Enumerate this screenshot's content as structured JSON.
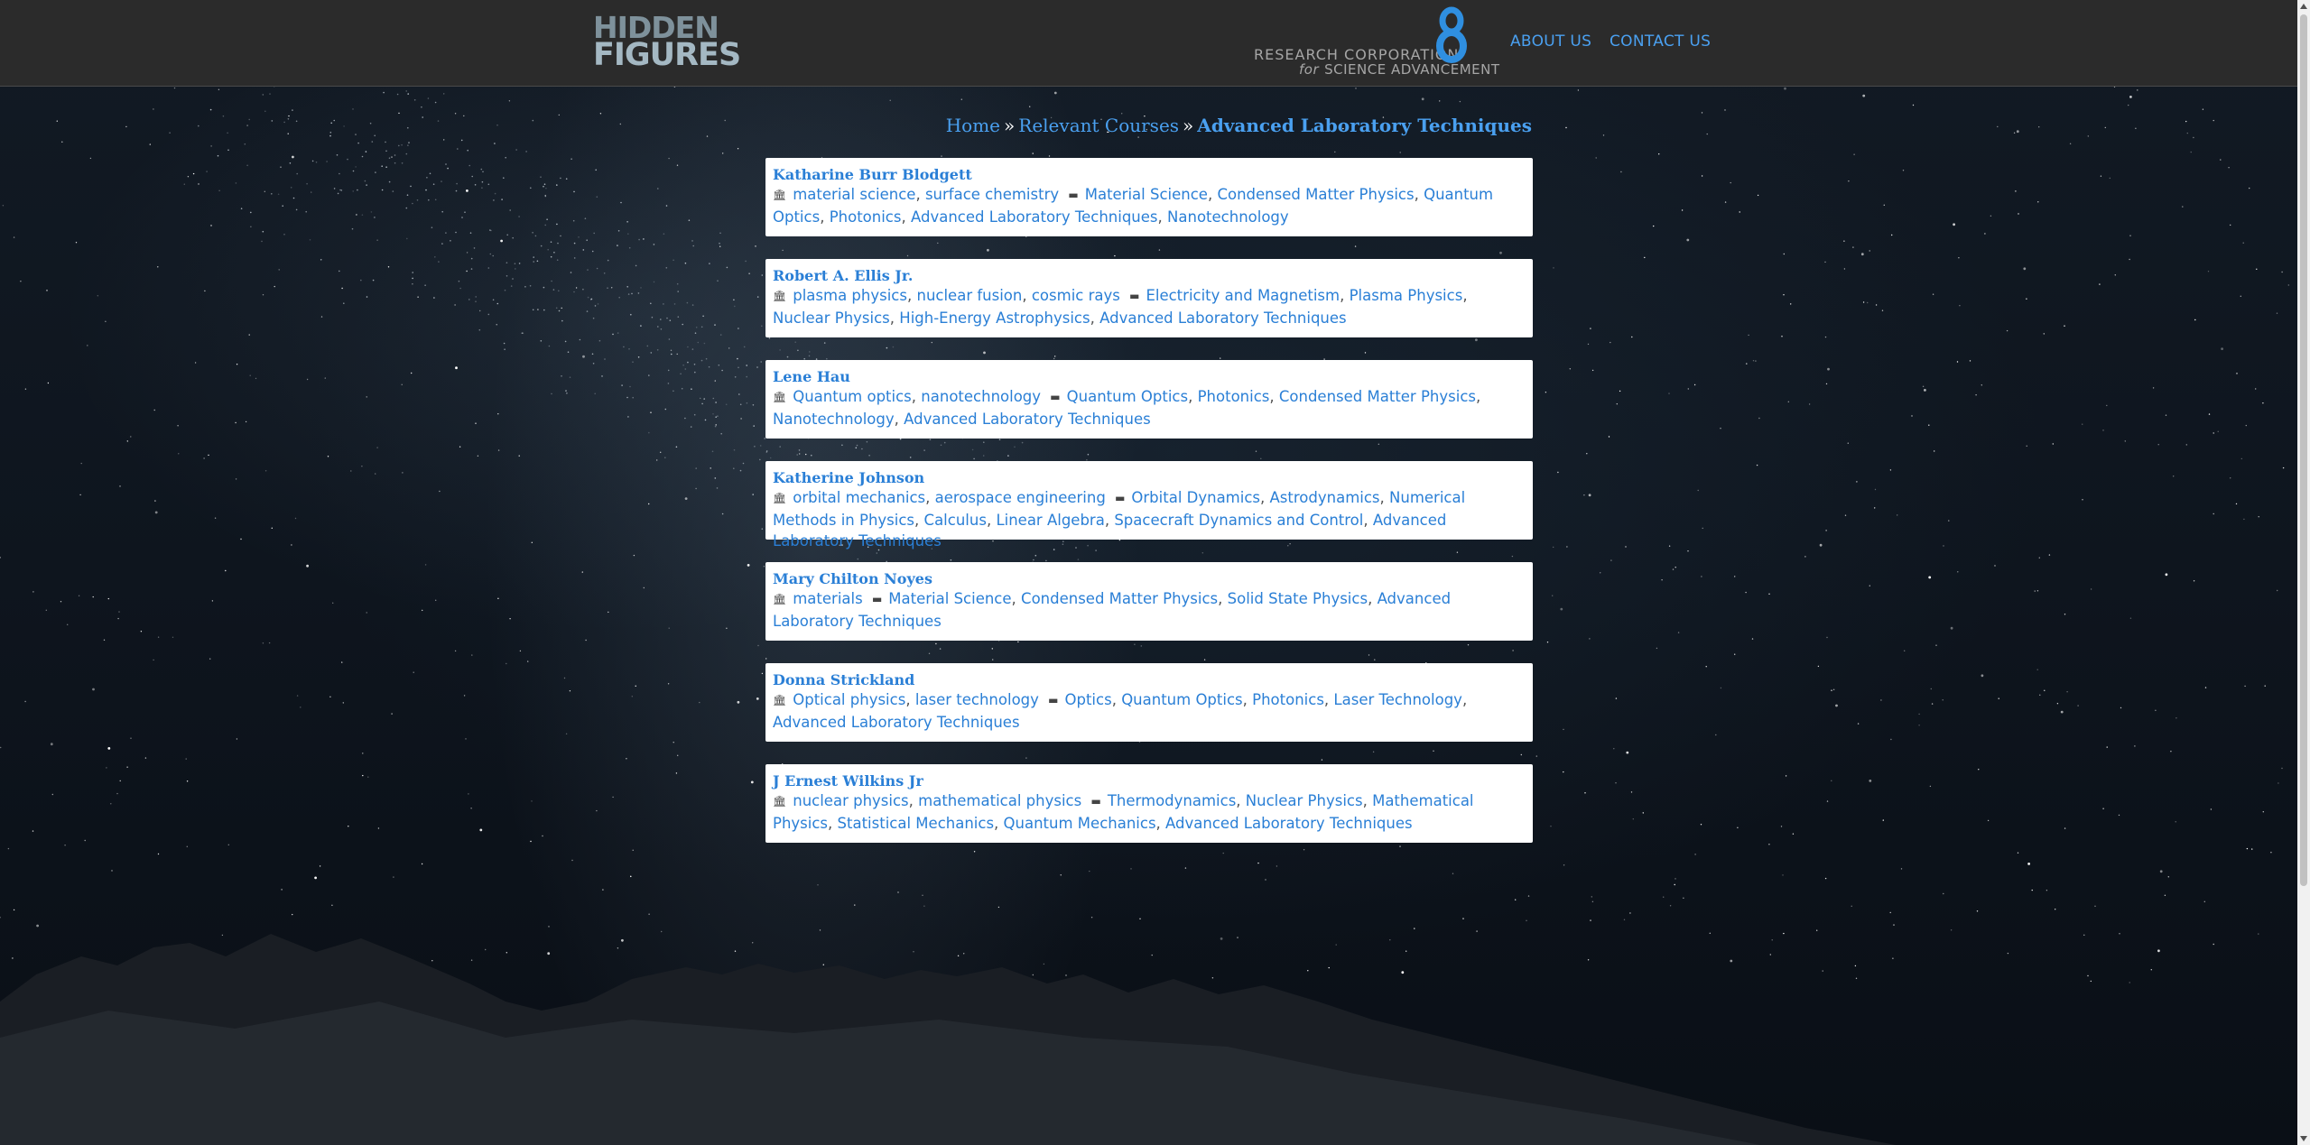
{
  "header": {
    "logo_line1": "HIDDEN",
    "logo_line2": "FIGURES",
    "org_line1": "RESEARCH CORPORATION",
    "org_line2_for": "for",
    "org_line2_rest": "SCIENCE ADVANCEMENT",
    "nav": {
      "about": "ABOUT US",
      "contact": "CONTACT US"
    }
  },
  "breadcrumb": {
    "home": "Home",
    "sep": "»",
    "parent": "Relevant Courses",
    "current": "Advanced Laboratory Techniques"
  },
  "icons": {
    "field": "institution-icon",
    "course": "book-icon"
  },
  "colors": {
    "link": "#2a7fd6",
    "nav": "#4aa0f0",
    "header_bg": "#2b2b2b"
  },
  "people": [
    {
      "name": "Katharine Burr Blodgett",
      "fields": [
        "material science",
        "surface chemistry"
      ],
      "courses": [
        "Material Science",
        "Condensed Matter Physics",
        "Quantum Optics",
        "Photonics",
        "Advanced Laboratory Techniques",
        "Nanotechnology"
      ]
    },
    {
      "name": "Robert A. Ellis Jr.",
      "fields": [
        "plasma physics",
        "nuclear fusion",
        "cosmic rays"
      ],
      "courses": [
        "Electricity and Magnetism",
        "Plasma Physics",
        "Nuclear Physics",
        "High-Energy Astrophysics",
        "Advanced Laboratory Techniques"
      ]
    },
    {
      "name": "Lene Hau",
      "fields": [
        "Quantum optics",
        "nanotechnology"
      ],
      "courses": [
        "Quantum Optics",
        "Photonics",
        "Condensed Matter Physics",
        "Nanotechnology",
        "Advanced Laboratory Techniques"
      ]
    },
    {
      "name": "Katherine Johnson",
      "fields": [
        "orbital mechanics",
        "aerospace engineering"
      ],
      "courses": [
        "Orbital Dynamics",
        "Astrodynamics",
        "Numerical Methods in Physics",
        "Calculus",
        "Linear Algebra",
        "Spacecraft Dynamics and Control",
        "Advanced Laboratory Techniques"
      ]
    },
    {
      "name": "Mary Chilton Noyes",
      "fields": [
        "materials"
      ],
      "courses": [
        "Material Science",
        "Condensed Matter Physics",
        "Solid State Physics",
        "Advanced Laboratory Techniques"
      ]
    },
    {
      "name": "Donna Strickland",
      "fields": [
        "Optical physics",
        "laser technology"
      ],
      "courses": [
        "Optics",
        "Quantum Optics",
        "Photonics",
        "Laser Technology",
        "Advanced Laboratory Techniques"
      ]
    },
    {
      "name": "J Ernest Wilkins Jr",
      "fields": [
        "nuclear physics",
        "mathematical physics"
      ],
      "courses": [
        "Thermodynamics",
        "Nuclear Physics",
        "Mathematical Physics",
        "Statistical Mechanics",
        "Quantum Mechanics",
        "Advanced Laboratory Techniques"
      ]
    }
  ]
}
